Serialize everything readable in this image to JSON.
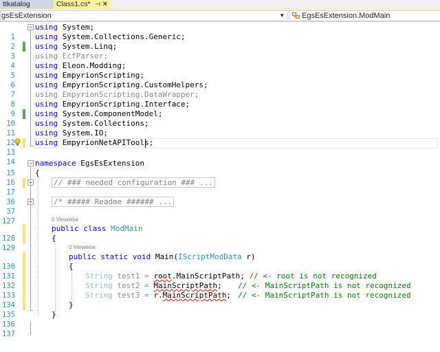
{
  "tabs": {
    "inactive_label": "ttkatalog",
    "active_label": "Class1.cs*",
    "pin_icon": "pin-icon",
    "close_icon": "close-icon"
  },
  "navbar": {
    "left_value": "gsEsExtension",
    "right_value": "EgsEsExtension.ModMain"
  },
  "editor": {
    "line_numbers": [
      "1",
      "2",
      "3",
      "4",
      "5",
      "6",
      "7",
      "8",
      "9",
      "10",
      "11",
      "12",
      "13",
      "14",
      "15",
      "16",
      "17",
      "36",
      "37",
      "127",
      "128",
      "129",
      "130",
      "131",
      "132",
      "133",
      "134",
      "135",
      "136",
      "137"
    ],
    "usings": [
      {
        "kw": "using",
        "rest": " System;",
        "dim": false
      },
      {
        "kw": "using",
        "rest": " System.Collections.Generic;",
        "dim": false
      },
      {
        "kw": "using",
        "rest": " System.Linq;",
        "dim": false
      },
      {
        "kw": "using",
        "rest": " EcfParser;",
        "dim": true
      },
      {
        "kw": "using",
        "rest": " Eleon.Modding;",
        "dim": false
      },
      {
        "kw": "using",
        "rest": " EmpyrionScripting;",
        "dim": false
      },
      {
        "kw": "using",
        "rest": " EmpyrionScripting.CustomHelpers;",
        "dim": false
      },
      {
        "kw": "using",
        "rest": " EmpyrionScripting.DataWrapper;",
        "dim": true
      },
      {
        "kw": "using",
        "rest": " EmpyrionScripting.Interface;",
        "dim": false
      },
      {
        "kw": "using",
        "rest": " System.ComponentModel;",
        "dim": false
      },
      {
        "kw": "using",
        "rest": " System.Collections;",
        "dim": false
      },
      {
        "kw": "using",
        "rest": " System.IO;",
        "dim": false
      },
      {
        "kw": "using",
        "rest": " EmpyrionNetAPITools;",
        "dim": false
      }
    ],
    "namespace_kw": "namespace",
    "namespace_name": " EgsEsExtension",
    "open_brace": "{",
    "close_brace": "}",
    "collapsed1": "// ### needed configuration ### ...",
    "collapsed2": "/* ##### Readme ###### ...",
    "class_refs": "0 Verweise",
    "class_kw": "public class",
    "class_name": "ModMain",
    "method_refs": "0 Verweise",
    "method_kw": "public static void",
    "method_name": " Main(",
    "param_type": "IScriptModData",
    "param_rest": " r)",
    "stmt1": {
      "type": "String",
      "var": " test1 = ",
      "expr_a": "root",
      "expr_b": ".MainScriptPath;",
      "comment": " // <- root is not recognized"
    },
    "stmt2": {
      "type": "String",
      "var": " test2 = ",
      "expr": "MainScriptPath",
      "tail": ";",
      "comment": "// <- MainScriptPath is not recognized"
    },
    "stmt3": {
      "type": "String",
      "var": " test3 = ",
      "expr_a": "r.",
      "expr_b": "MainScriptPath",
      "tail": ";",
      "comment": "// <- MainScriptPath is not recognized"
    },
    "colors": {
      "keyword": "#0000ff",
      "type": "#2b91af",
      "comment": "#008000",
      "line_number": "#2b91af",
      "change_saved": "#57a64a",
      "change_unsaved": "#f5e56a"
    }
  }
}
